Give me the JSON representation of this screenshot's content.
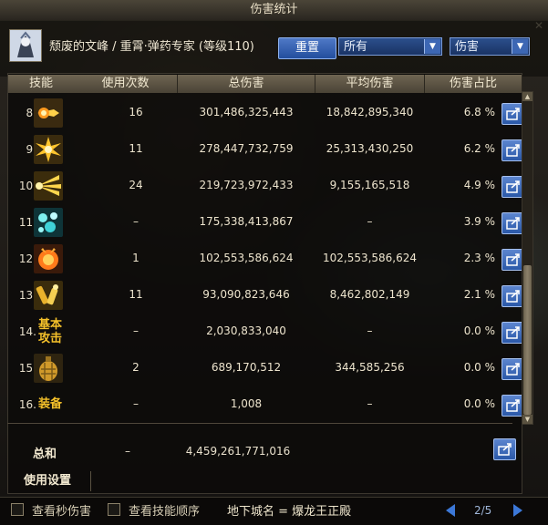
{
  "window": {
    "title": "伤害统计"
  },
  "character": {
    "name": "颓废的文峰 / 重霄·弹药专家 (等级110)"
  },
  "toolbar": {
    "reset_label": "重置",
    "filter_value": "所有",
    "metric_value": "伤害"
  },
  "table": {
    "headers": [
      "技能",
      "使用次数",
      "总伤害",
      "平均伤害",
      "伤害占比"
    ],
    "rows": [
      {
        "index": "8.",
        "icon": "flame-burst-skill-icon",
        "count": "16",
        "total": "301,486,325,443",
        "avg": "18,842,895,340",
        "pct": "6.8 %"
      },
      {
        "index": "9.",
        "icon": "starburst-explosion-skill-icon",
        "count": "11",
        "total": "278,447,732,759",
        "avg": "25,313,430,250",
        "pct": "6.2 %"
      },
      {
        "index": "10.",
        "icon": "bullet-spray-skill-icon",
        "count": "24",
        "total": "219,723,972,433",
        "avg": "9,155,165,518",
        "pct": "4.9 %"
      },
      {
        "index": "11.",
        "icon": "ice-crystal-skill-icon",
        "count": "–",
        "total": "175,338,413,867",
        "avg": "–",
        "pct": "3.9 %"
      },
      {
        "index": "12.",
        "icon": "fire-grenade-skill-icon",
        "count": "1",
        "total": "102,553,586,624",
        "avg": "102,553,586,624",
        "pct": "2.3 %"
      },
      {
        "index": "13.",
        "icon": "shell-casings-skill-icon",
        "count": "11",
        "total": "93,090,823,646",
        "avg": "8,462,802,149",
        "pct": "2.1 %"
      },
      {
        "index": "14.",
        "label": "基本攻击",
        "count": "–",
        "total": "2,030,833,040",
        "avg": "–",
        "pct": "0.0 %"
      },
      {
        "index": "15.",
        "icon": "grenade-skill-icon",
        "count": "2",
        "total": "689,170,512",
        "avg": "344,585,256",
        "pct": "0.0 %"
      },
      {
        "index": "16.",
        "label": "装备",
        "count": "–",
        "total": "1,008",
        "avg": "–",
        "pct": "0.0 %"
      }
    ],
    "summary": {
      "label": "总和",
      "count": "–",
      "total": "4,459,261,771,016"
    }
  },
  "settings_label": "使用设置",
  "footer": {
    "check_dps_label": "查看秒伤害",
    "check_order_label": "查看技能顺序",
    "dungeon_text": "地下城名 = 爆龙王正殿",
    "page": "2/5"
  },
  "colors": {
    "accent_blue": "#2f5fb0",
    "label_gold": "#f4c02a",
    "header_bg": "#5a5140"
  }
}
